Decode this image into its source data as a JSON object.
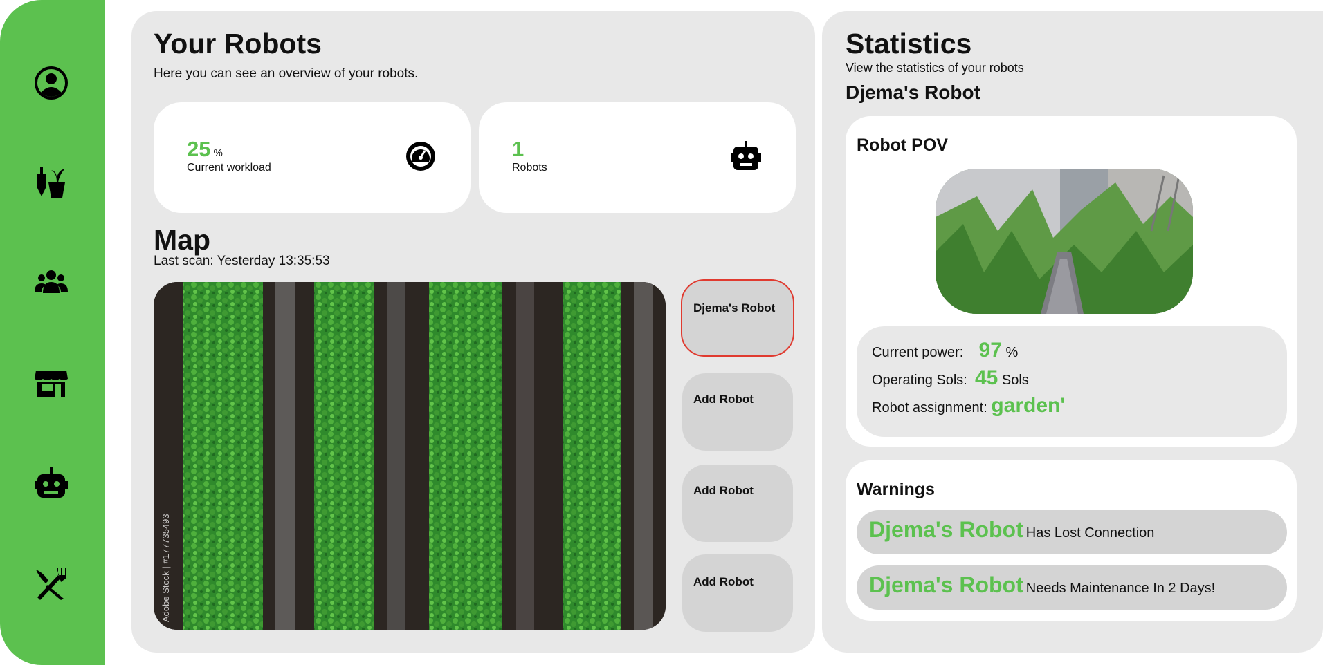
{
  "sidebar": {
    "items": [
      {
        "name": "profile",
        "icon": "user-circle-icon"
      },
      {
        "name": "garden",
        "icon": "garden-tools-icon"
      },
      {
        "name": "community",
        "icon": "users-icon"
      },
      {
        "name": "shop",
        "icon": "store-icon"
      },
      {
        "name": "robots",
        "icon": "robot-icon"
      },
      {
        "name": "food",
        "icon": "fork-knife-icon"
      }
    ],
    "color": "#5cc14f"
  },
  "overview": {
    "title": "Your Robots",
    "subtitle": "Here you can see an overview of your robots.",
    "workload": {
      "value": "25",
      "unit": "%",
      "label": "Current workload",
      "icon": "gauge-icon"
    },
    "robots": {
      "value": "1",
      "label": "Robots",
      "icon": "robot-icon"
    }
  },
  "map": {
    "title": "Map",
    "last_scan": "Last scan: Yesterday 13:35:53",
    "watermark": "Adobe Stock | #177735493"
  },
  "robot_list": [
    {
      "label": "Djema's Robot",
      "selected": true
    },
    {
      "label": "Add Robot",
      "selected": false
    },
    {
      "label": "Add Robot",
      "selected": false
    },
    {
      "label": "Add Robot",
      "selected": false
    }
  ],
  "statistics": {
    "title": "Statistics",
    "subtitle": "View the statistics of your robots",
    "robot_name": "Djema's Robot",
    "pov_title": "Robot POV",
    "power_label": "Current power:",
    "power_value": "97",
    "power_unit": "%",
    "sols_label": "Operating Sols:",
    "sols_value": "45",
    "sols_unit": "Sols",
    "assignment_label": "Robot assignment:",
    "assignment_value": "garden'"
  },
  "warnings": {
    "title": "Warnings",
    "items": [
      {
        "robot": "Djema's Robot",
        "message": "Has Lost Connection"
      },
      {
        "robot": "Djema's Robot",
        "message": "Needs Maintenance In 2 Days!"
      }
    ]
  },
  "colors": {
    "accent": "#5cc14f",
    "selected_border": "#e03a2f",
    "panel": "#e8e8e8",
    "button": "#d4d4d4"
  }
}
